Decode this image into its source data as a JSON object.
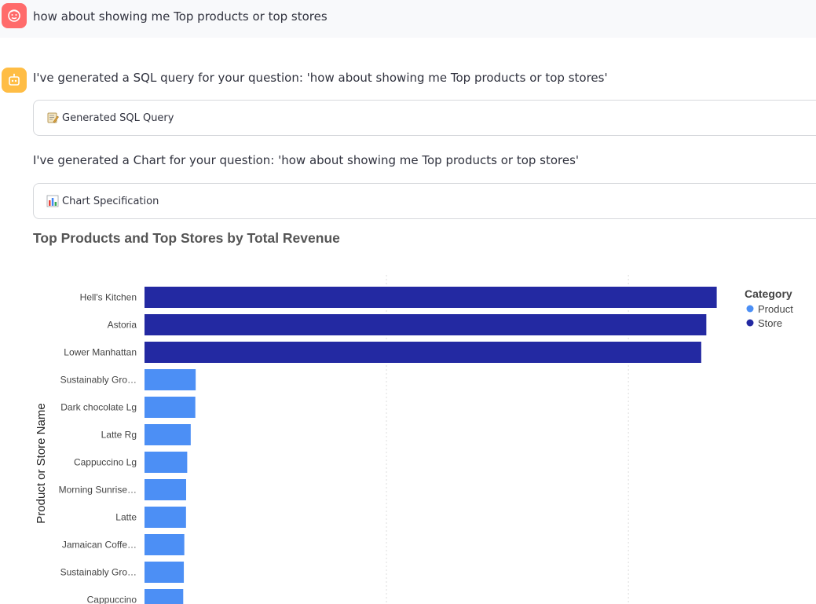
{
  "user_message": {
    "avatar_icon": "user-face-icon",
    "text": "how about showing me Top products or top stores"
  },
  "assistant": {
    "avatar_icon": "robot-icon",
    "sql_intro": "I've generated a SQL query for your question: 'how about showing me Top products or top stores'",
    "sql_expander_label": "Generated SQL Query",
    "sql_expander_icon": "memo-icon",
    "chart_intro": "I've generated a Chart for your question: 'how about showing me Top products or top stores'",
    "chart_expander_label": "Chart Specification",
    "chart_expander_icon": "bar-chart-icon"
  },
  "colors": {
    "product": "#4c8ff5",
    "store": "#2329a2"
  },
  "chart_data": {
    "type": "bar",
    "orientation": "horizontal",
    "title": "Top Products and Top Stores by Total Revenue",
    "ylabel": "Product or Store Name",
    "legend_title": "Category",
    "legend_position": "top-right",
    "grid": true,
    "series": [
      {
        "name": "Product",
        "color": "#4c8ff5"
      },
      {
        "name": "Store",
        "color": "#2329a2"
      }
    ],
    "categories": [
      "Hell's Kitchen",
      "Astoria",
      "Lower Manhattan",
      "Sustainably Gro…",
      "Dark chocolate Lg",
      "Latte Rg",
      "Cappuccino Lg",
      "Morning Sunrise…",
      "Latte",
      "Jamaican Coffe…",
      "Sustainably Gro…",
      "Cappuccino"
    ],
    "category_type": [
      "Store",
      "Store",
      "Store",
      "Product",
      "Product",
      "Product",
      "Product",
      "Product",
      "Product",
      "Product",
      "Product",
      "Product"
    ],
    "values": [
      236500,
      232200,
      230100,
      21150,
      21000,
      19100,
      17650,
      17200,
      17150,
      16450,
      16250,
      16000
    ],
    "xlim": [
      0,
      260000
    ]
  }
}
